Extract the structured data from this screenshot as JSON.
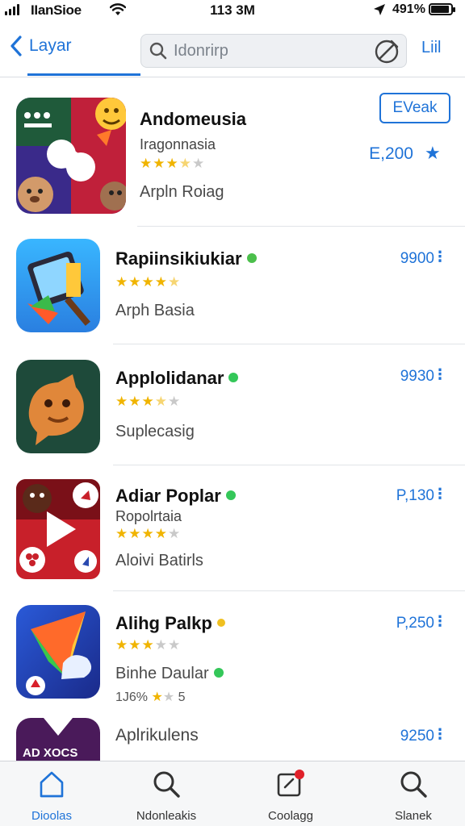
{
  "status_bar": {
    "carrier": "IIanSioe",
    "time": "113 3M",
    "battery": "491%",
    "battery_level": 0.9
  },
  "nav": {
    "back_label": "Layar",
    "search_placeholder": "Idonrirp",
    "right_label": "Liil"
  },
  "apps": [
    {
      "name": "Andomeusia",
      "subtitle": "Iragonnasia",
      "rating": 3.5,
      "category": "Arpln Roiag",
      "action_label": "EVeak",
      "price": "E,200"
    },
    {
      "name": "Rapiinsikiukiar",
      "rating": 4.5,
      "category": "Arph Basia",
      "price": "9900"
    },
    {
      "name": "Applolidanar",
      "rating": 3.5,
      "category": "Suplecasig",
      "price": "9930"
    },
    {
      "name": "Adiar Poplar",
      "subtitle": "Ropolrtaia",
      "rating": 4,
      "category": "Aloivi Batirls",
      "price": "P,130"
    },
    {
      "name": "Alihg Palkp",
      "rating": 3,
      "category": "Binhe Daular",
      "meta": "1J6%",
      "meta_count": "5",
      "price": "P,250"
    },
    {
      "name": "Aplrikulens",
      "icon_text": "AD XOCS",
      "price": "9250"
    }
  ],
  "tabs": [
    {
      "label": "Dioolas",
      "icon": "home-icon",
      "active": true
    },
    {
      "label": "Ndonleakis",
      "icon": "search-icon"
    },
    {
      "label": "Coolagg",
      "icon": "updates-icon"
    },
    {
      "label": "Slanek",
      "icon": "search-icon"
    }
  ],
  "colors": {
    "accent": "#1f73d8",
    "star": "#f0b400",
    "badge_green": "#34c759",
    "badge_yellow": "#f0b400"
  }
}
